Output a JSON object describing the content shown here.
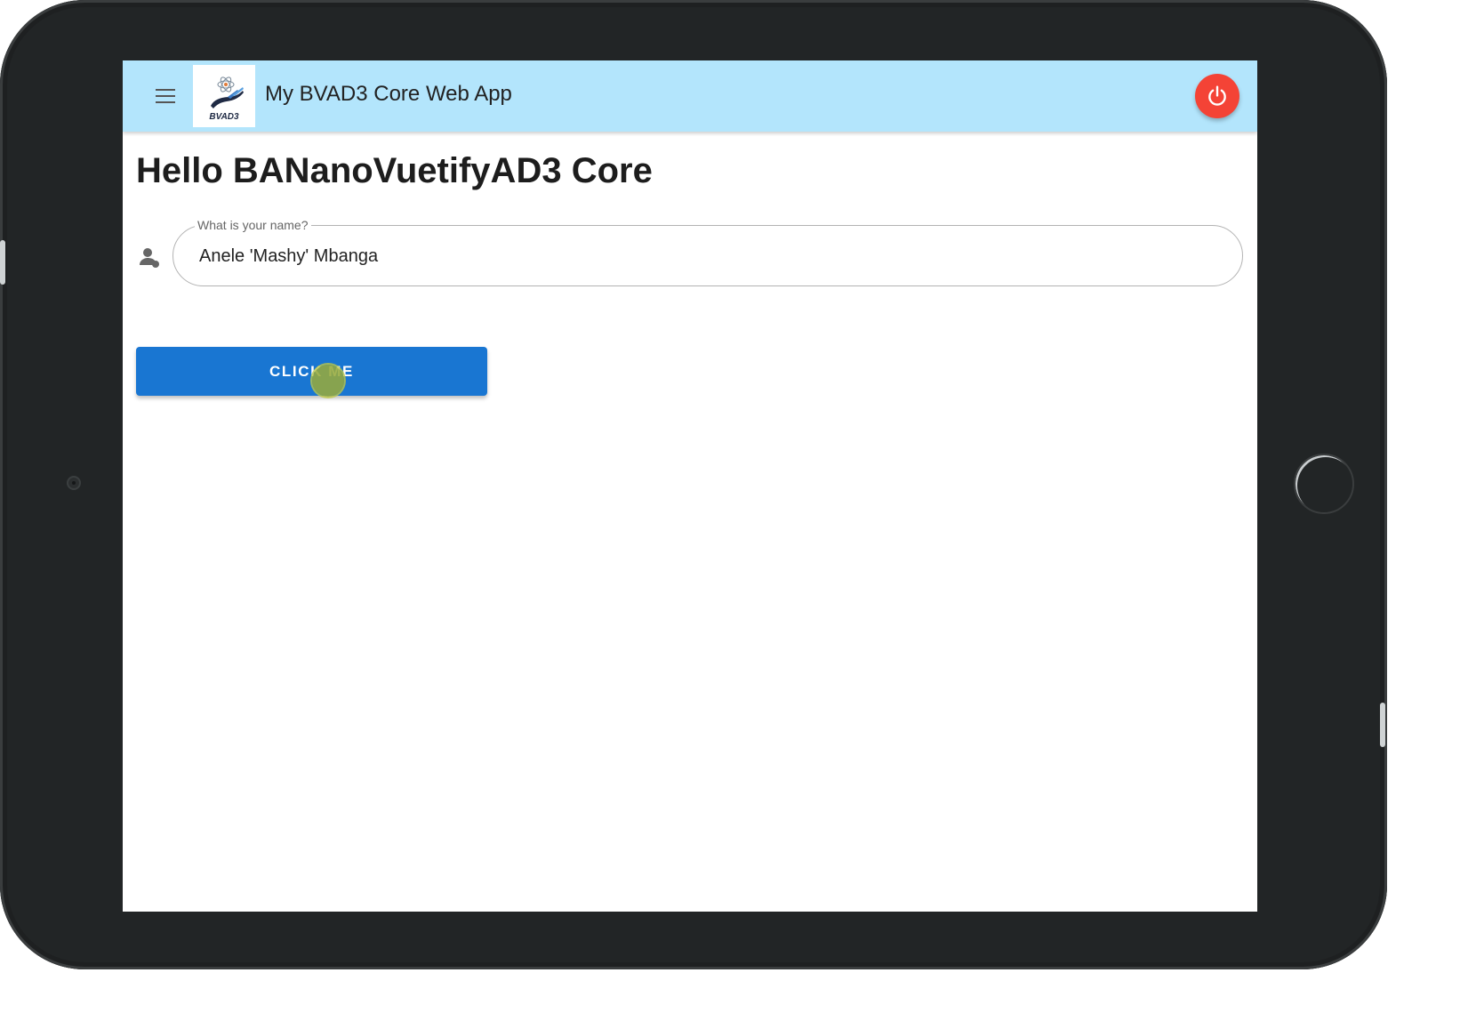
{
  "appbar": {
    "title": "My BVAD3 Core Web App",
    "logo_text": "BVAD3",
    "color": "#b3e5fc"
  },
  "page": {
    "title": "Hello BANanoVuetifyAD3 Core"
  },
  "name_field": {
    "label": "What is your name?",
    "value": "Anele 'Mashy' Mbanga",
    "icon": "account-icon"
  },
  "button": {
    "label": "CLICK ME",
    "color": "#1976d2"
  },
  "power_button": {
    "icon": "power-icon",
    "color": "#f44336"
  }
}
